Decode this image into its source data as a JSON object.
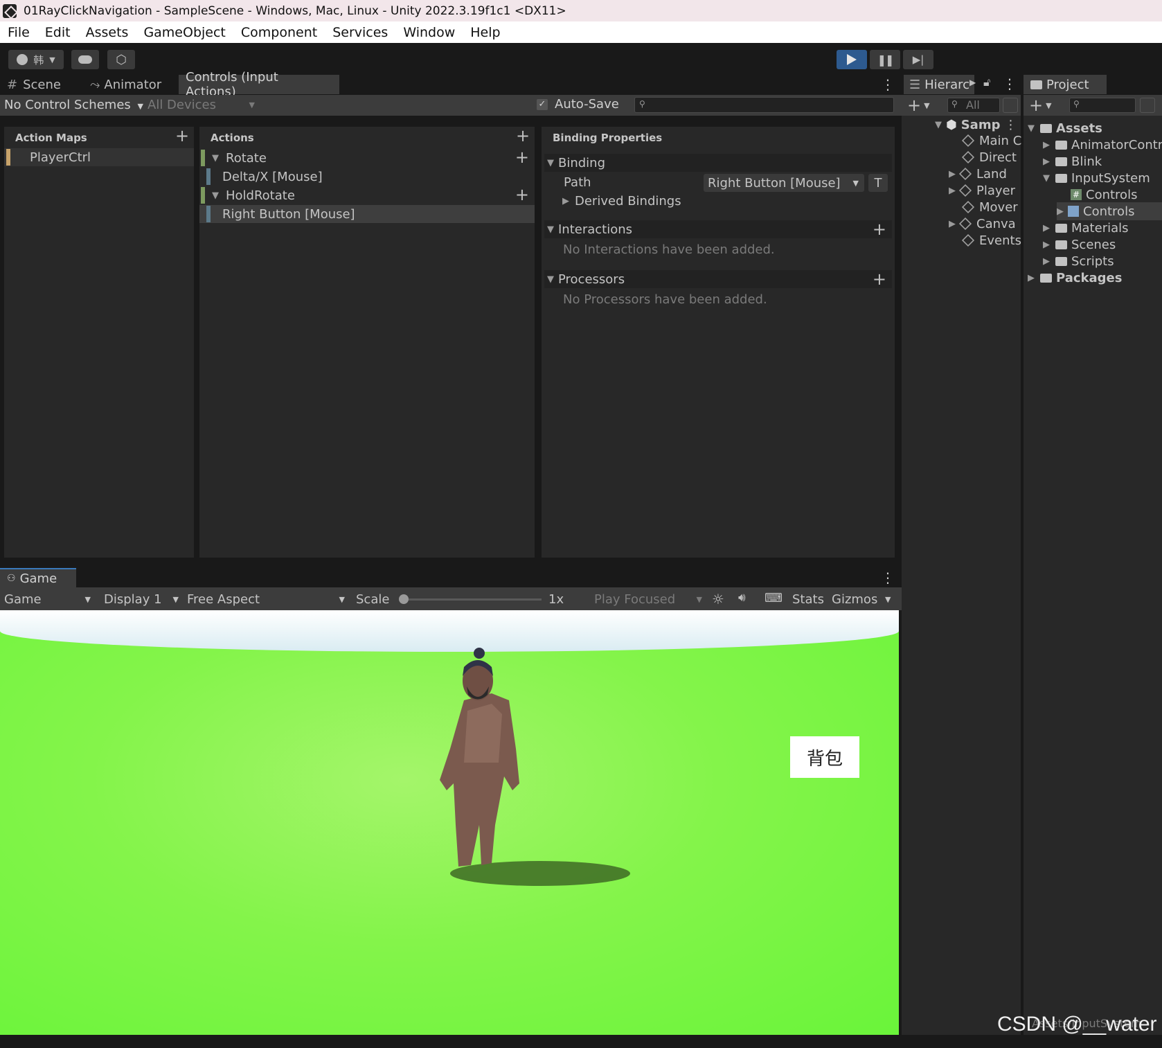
{
  "window": {
    "title": "01RayClickNavigation - SampleScene - Windows, Mac, Linux - Unity 2022.3.19f1c1 <DX11>"
  },
  "menu": [
    "File",
    "Edit",
    "Assets",
    "GameObject",
    "Component",
    "Services",
    "Window",
    "Help"
  ],
  "toolbar": {
    "account_label": "韩"
  },
  "tabs": {
    "scene": "Scene",
    "animator": "Animator",
    "controls": "Controls (Input Actions)"
  },
  "input_actions": {
    "control_schemes": "No Control Schemes",
    "devices": "All Devices",
    "auto_save": "Auto-Save",
    "action_maps_header": "Action Maps",
    "actions_header": "Actions",
    "binding_header": "Binding Properties",
    "action_maps": [
      "PlayerCtrl"
    ],
    "actions": [
      {
        "name": "Rotate",
        "binding": "Delta/X [Mouse]"
      },
      {
        "name": "HoldRotate",
        "binding": "Right Button [Mouse]"
      }
    ],
    "binding": {
      "section": "Binding",
      "path_label": "Path",
      "path_value": "Right Button [Mouse]",
      "t_button": "T",
      "derived": "Derived Bindings",
      "interactions": "Interactions",
      "no_interactions": "No Interactions have been added.",
      "processors": "Processors",
      "no_processors": "No Processors have been added."
    }
  },
  "hierarchy": {
    "tab": "Hierarc",
    "search_placeholder": "All",
    "scene": "Samp",
    "items": [
      "Main C",
      "Direct",
      "Land",
      "Player",
      "Mover",
      "Canva",
      "Events"
    ]
  },
  "project": {
    "tab": "Project",
    "assets": "Assets",
    "items": [
      "AnimatorContro",
      "Blink",
      "InputSystem",
      "Controls",
      "Controls",
      "Materials",
      "Scenes",
      "Scripts"
    ],
    "packages": "Packages",
    "footer_path": "Assets/InputSystem"
  },
  "game": {
    "tab": "Game",
    "mode": "Game",
    "display": "Display 1",
    "aspect": "Free Aspect",
    "scale_label": "Scale",
    "scale_value": "1x",
    "play_focused": "Play Focused",
    "stats": "Stats",
    "gizmos": "Gizmos",
    "bag_button": "背包"
  },
  "watermark": "CSDN @__water"
}
